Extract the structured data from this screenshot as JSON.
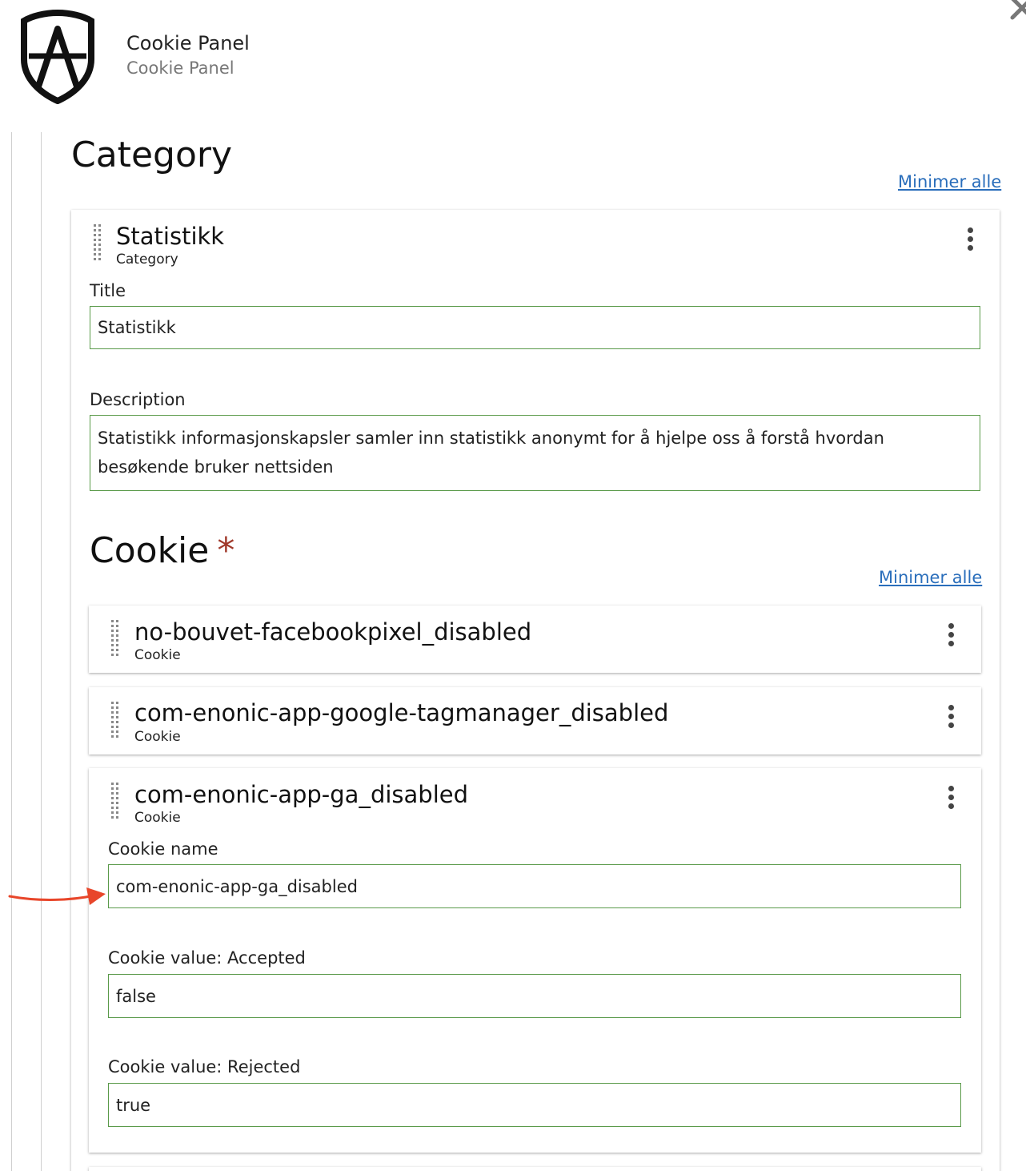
{
  "header": {
    "app_title": "Cookie Panel",
    "app_subtitle": "Cookie Panel",
    "logo_icon": "shield-a-logo-icon",
    "close_icon": "close-icon"
  },
  "category_section": {
    "title": "Category",
    "minimize_label": "Minimer alle",
    "item": {
      "title": "Statistikk",
      "type": "Category",
      "fields": {
        "title_label": "Title",
        "title_value": "Statistikk",
        "description_label": "Description",
        "description_value": "Statistikk informasjonskapsler samler inn statistikk anonymt for å hjelpe oss å forstå hvordan besøkende bruker nettsiden"
      }
    }
  },
  "cookie_section": {
    "title": "Cookie",
    "required_marker": "*",
    "minimize_label": "Minimer alle",
    "items": [
      {
        "title": "no-bouvet-facebookpixel_disabled",
        "type": "Cookie"
      },
      {
        "title": "com-enonic-app-google-tagmanager_disabled",
        "type": "Cookie"
      },
      {
        "title": "com-enonic-app-ga_disabled",
        "type": "Cookie",
        "fields": {
          "name_label": "Cookie name",
          "name_value": "com-enonic-app-ga_disabled",
          "accepted_label": "Cookie value: Accepted",
          "accepted_value": "false",
          "rejected_label": "Cookie value: Rejected",
          "rejected_value": "true"
        }
      }
    ]
  },
  "colors": {
    "link": "#2a6ebb",
    "input_border": "#5a9a4a",
    "required": "#a0392b",
    "annotation_arrow": "#e8462a"
  }
}
